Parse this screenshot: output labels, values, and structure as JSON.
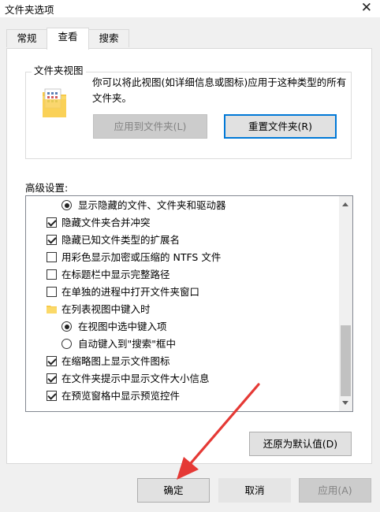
{
  "window": {
    "title": "文件夹选项"
  },
  "tabs": [
    {
      "label": "常规",
      "active": false
    },
    {
      "label": "查看",
      "active": true
    },
    {
      "label": "搜索",
      "active": false
    }
  ],
  "folder_views": {
    "group_label": "文件夹视图",
    "description": "你可以将此视图(如详细信息或图标)应用于这种类型的所有文件夹。",
    "apply_button": {
      "label": "应用到文件夹(L)",
      "enabled": false
    },
    "reset_button": {
      "label": "重置文件夹(R)",
      "enabled": true,
      "focused": true
    }
  },
  "advanced": {
    "label": "高级设置:",
    "items": [
      {
        "type": "radio",
        "checked": true,
        "label": "显示隐藏的文件、文件夹和驱动器",
        "indent": 1
      },
      {
        "type": "checkbox",
        "checked": true,
        "label": "隐藏文件夹合并冲突",
        "indent": 0
      },
      {
        "type": "checkbox",
        "checked": true,
        "label": "隐藏已知文件类型的扩展名",
        "indent": 0
      },
      {
        "type": "checkbox",
        "checked": false,
        "label": "用彩色显示加密或压缩的 NTFS 文件",
        "indent": 0
      },
      {
        "type": "checkbox",
        "checked": false,
        "label": "在标题栏中显示完整路径",
        "indent": 0
      },
      {
        "type": "checkbox",
        "checked": false,
        "label": "在单独的进程中打开文件夹窗口",
        "indent": 0
      },
      {
        "type": "folder",
        "label": "在列表视图中键入时",
        "indent": 0
      },
      {
        "type": "radio",
        "checked": true,
        "label": "在视图中选中键入项",
        "indent": 1
      },
      {
        "type": "radio",
        "checked": false,
        "label": "自动键入到\"搜索\"框中",
        "indent": 1
      },
      {
        "type": "checkbox",
        "checked": true,
        "label": "在缩略图上显示文件图标",
        "indent": 0
      },
      {
        "type": "checkbox",
        "checked": true,
        "label": "在文件夹提示中显示文件大小信息",
        "indent": 0
      },
      {
        "type": "checkbox",
        "checked": true,
        "label": "在预览窗格中显示预览控件",
        "indent": 0
      }
    ],
    "restore_button": {
      "label": "还原为默认值(D)"
    }
  },
  "footer": {
    "ok": {
      "label": "确定"
    },
    "cancel": {
      "label": "取消"
    },
    "apply": {
      "label": "应用(A)",
      "enabled": false
    }
  },
  "colors": {
    "focus": "#0078d7",
    "annotation_arrow": "#e53935"
  }
}
